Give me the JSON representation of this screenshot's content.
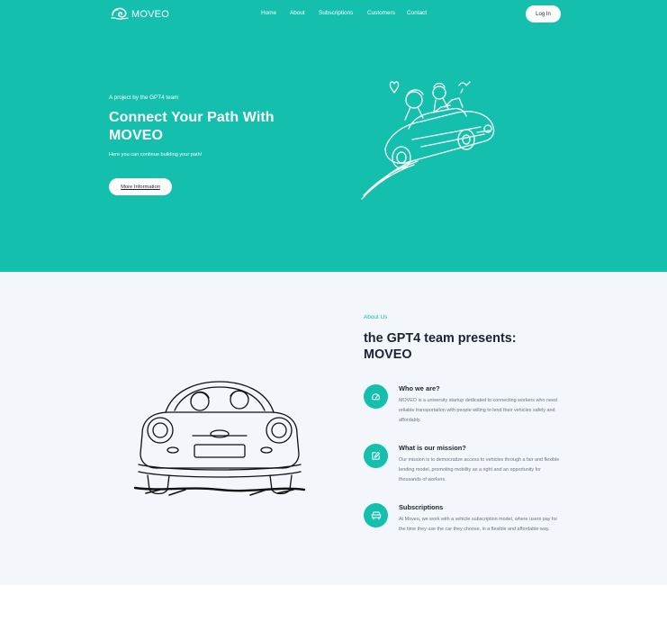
{
  "brand": {
    "name": "MOVEO",
    "logo_icon": "wave-swirl-logo-icon"
  },
  "nav": {
    "items": [
      "Home",
      "About",
      "Subscriptions",
      "Customers",
      "Contact"
    ]
  },
  "header": {
    "login_label": "Log In"
  },
  "hero": {
    "eyebrow": "A project by the GPT4 team",
    "title": "Connect Your Path With MOVEO",
    "subtitle": "Here you can continue building your path!",
    "cta_label": "More Information",
    "illustration": "couple-driving-car-sketch"
  },
  "about": {
    "eyebrow": "About Us",
    "title": "the GPT4 team presents: MOVEO",
    "illustration": "couple-in-car-front-view-sketch",
    "features": [
      {
        "icon": "speedometer-icon",
        "title": "Who we are?",
        "text": "MOVEO is a university startup dedicated to connecting workers who need reliable transportation with people willing to lend their vehicles safely and affordably."
      },
      {
        "icon": "edit-note-icon",
        "title": "What is our mission?",
        "text": "Our mission is to democratize access to vehicles through a fair and flexible lending model, promoting mobility as a right and an opportunity for thousands of workers."
      },
      {
        "icon": "car-subscription-icon",
        "title": "Subscriptions",
        "text": "At Moveo, we work with a vehicle subscription model, where users pay for the time they use the car they choose, in a flexible and affordable way."
      }
    ]
  },
  "colors": {
    "accent": "#14bfad",
    "dark_text": "#1c2431",
    "section_bg": "#f3f6fa",
    "muted_text": "#6b7480"
  }
}
